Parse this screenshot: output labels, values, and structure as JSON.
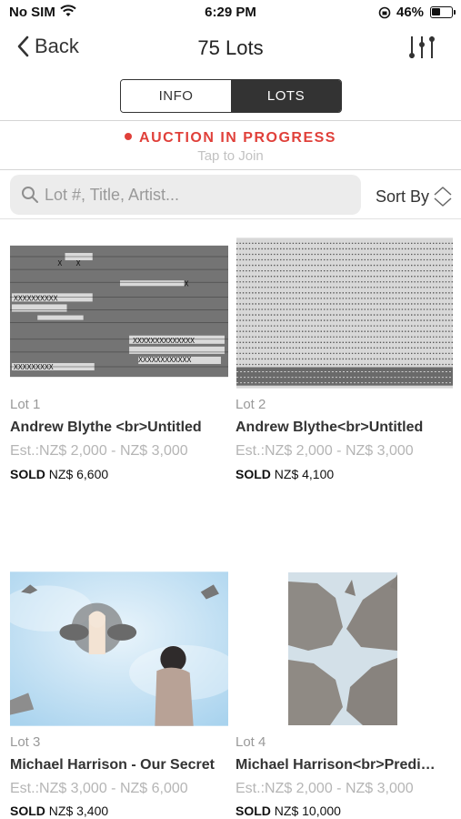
{
  "status_bar": {
    "carrier": "No SIM",
    "time": "6:29 PM",
    "battery": "46%"
  },
  "nav": {
    "back_label": "Back",
    "title": "75 Lots"
  },
  "tabs": {
    "info": "INFO",
    "lots": "LOTS",
    "selected": "LOTS"
  },
  "banner": {
    "status": "AUCTION IN PROGRESS",
    "action": "Tap to Join",
    "status_color": "#e0403a"
  },
  "search": {
    "placeholder": "Lot #, Title, Artist...",
    "value": ""
  },
  "sort": {
    "label": "Sort By"
  },
  "lots": [
    {
      "lot": "Lot 1",
      "name": "Andrew Blythe <br>Untitled",
      "estimate": "Est.:NZ$ 2,000 - NZ$ 3,000",
      "sold_label": "SOLD",
      "sold_price": "NZ$ 6,600"
    },
    {
      "lot": "Lot 2",
      "name": "Andrew Blythe<br>Untitled",
      "estimate": "Est.:NZ$ 2,000 - NZ$ 3,000",
      "sold_label": "SOLD",
      "sold_price": "NZ$ 4,100"
    },
    {
      "lot": "Lot 3",
      "name": "Michael Harrison - Our Secret",
      "estimate": "Est.:NZ$ 3,000 - NZ$ 6,000",
      "sold_label": "SOLD",
      "sold_price": "NZ$ 3,400"
    },
    {
      "lot": "Lot 4",
      "name": "Michael Harrison<br>Predi…",
      "estimate": "Est.:NZ$ 2,000 - NZ$ 3,000",
      "sold_label": "SOLD",
      "sold_price": "NZ$ 10,000"
    }
  ]
}
